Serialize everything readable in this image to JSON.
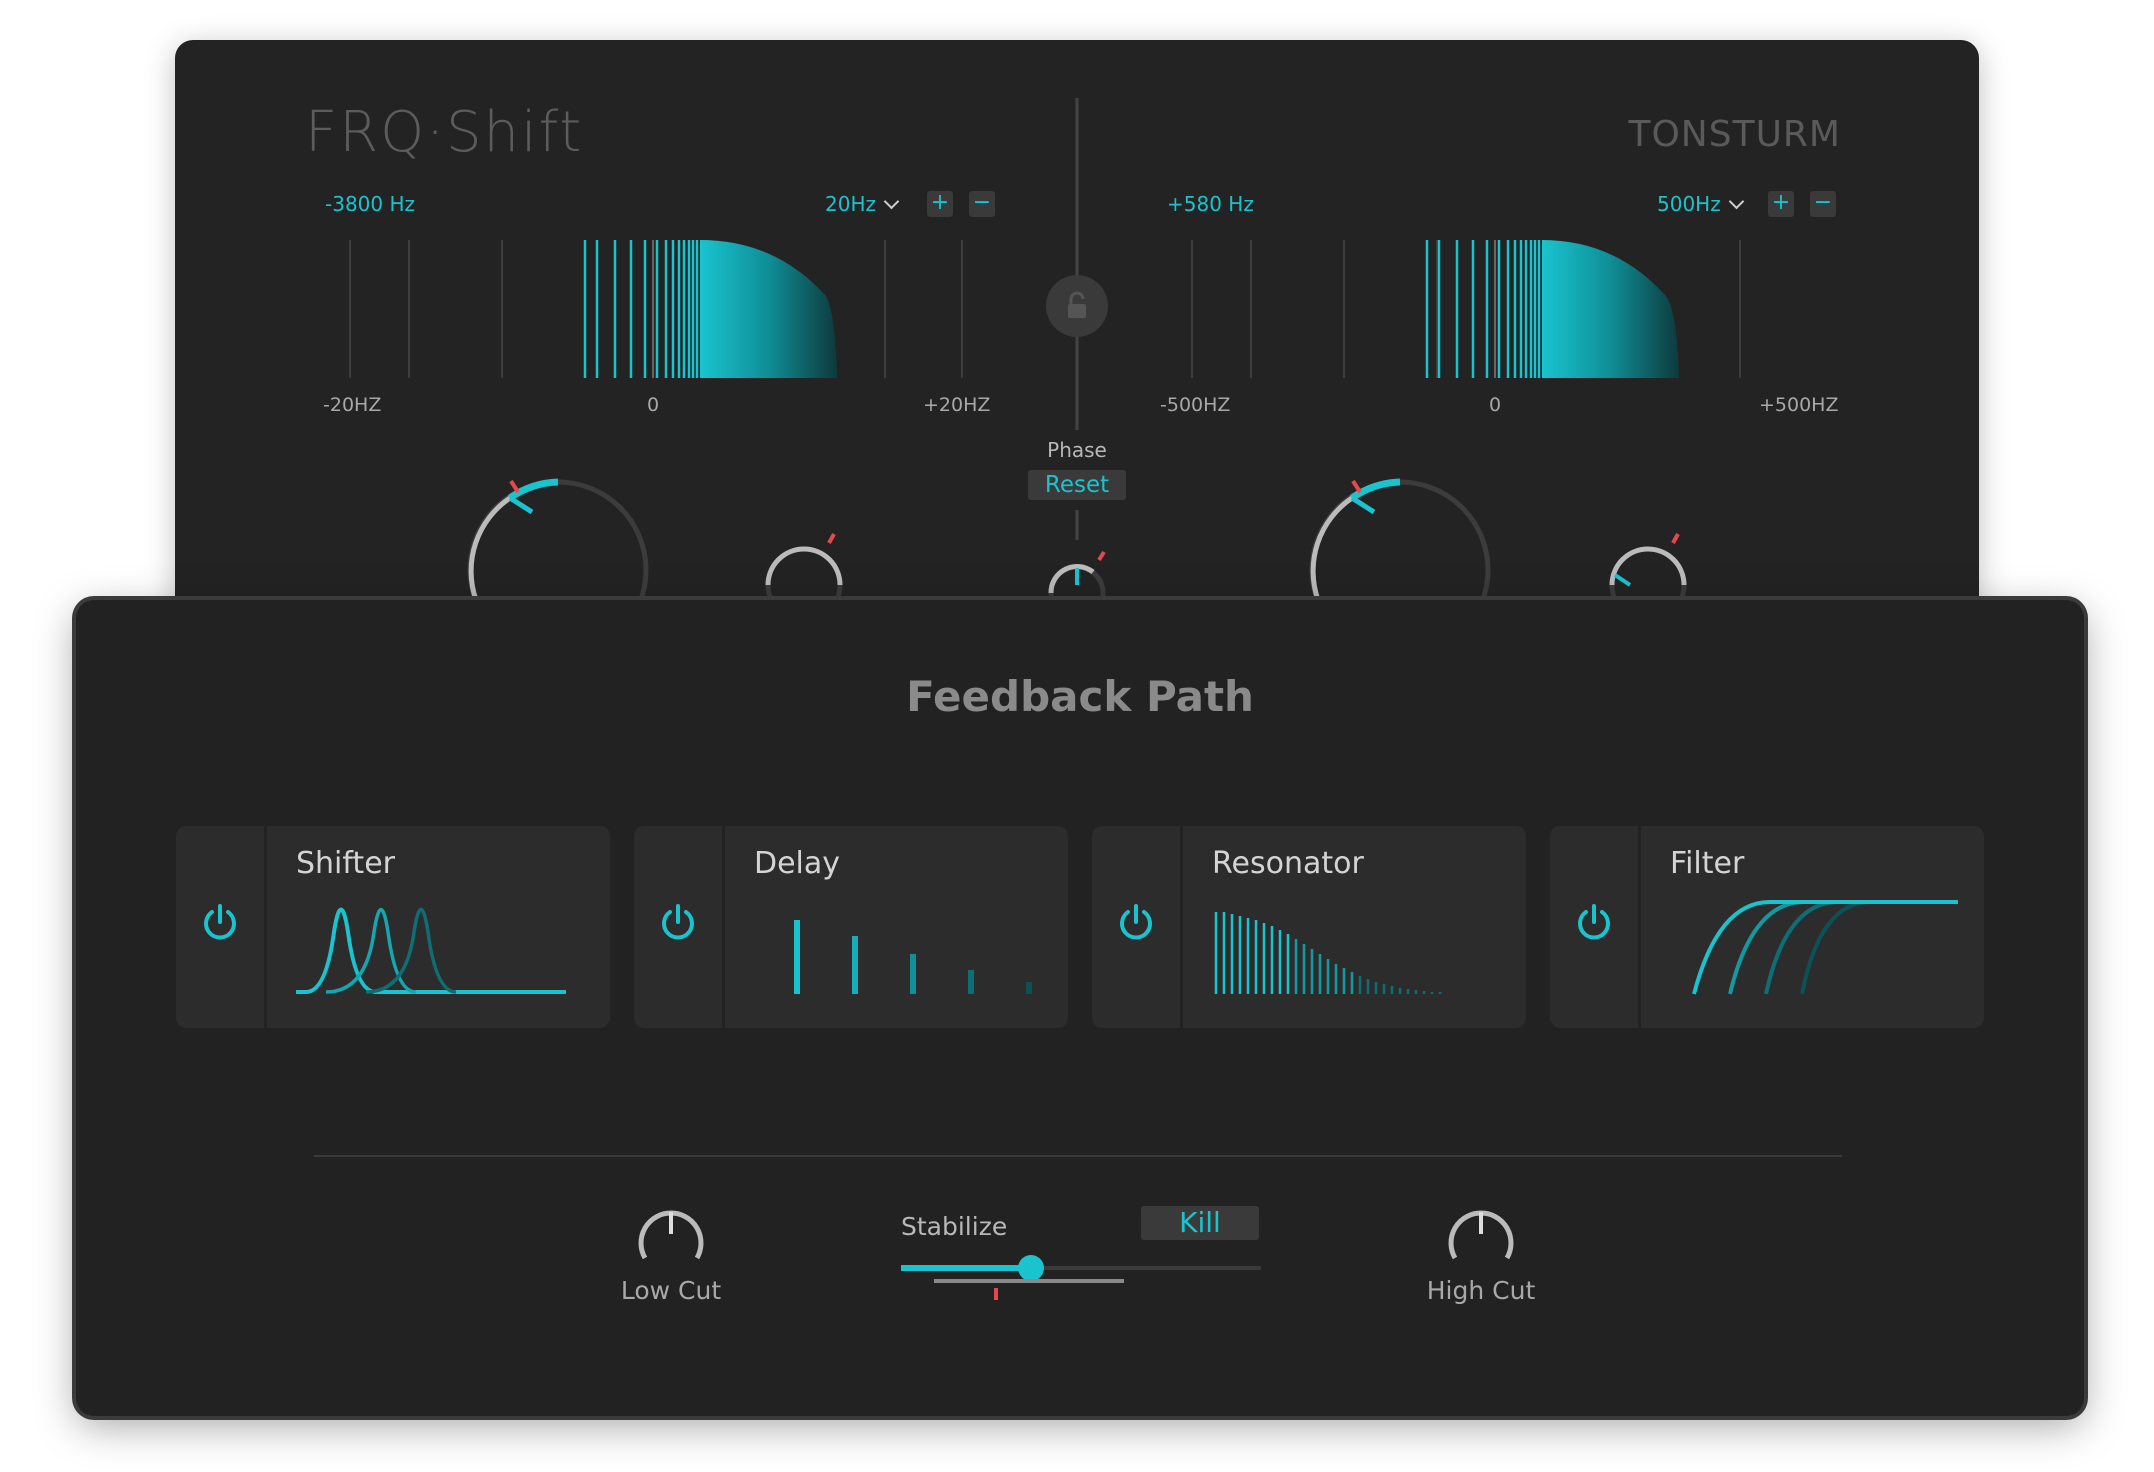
{
  "header": {
    "title": "FRQ·Shift",
    "vendor": "TONSTURM"
  },
  "left_shifter": {
    "frequency_readout": "-3800 Hz",
    "range_selected": "20Hz",
    "plus_label": "+",
    "minus_label": "−",
    "axis_min": "-20HZ",
    "axis_mid": "0",
    "axis_max": "+20HZ"
  },
  "right_shifter": {
    "frequency_readout": "+580 Hz",
    "range_selected": "500Hz",
    "plus_label": "+",
    "minus_label": "−",
    "axis_min": "-500HZ",
    "axis_mid": "0",
    "axis_max": "+500HZ"
  },
  "phase": {
    "label": "Phase",
    "reset_label": "Reset"
  },
  "feedback": {
    "title": "Feedback Path",
    "modules": [
      {
        "name": "Shifter",
        "enabled": true
      },
      {
        "name": "Delay",
        "enabled": true
      },
      {
        "name": "Resonator",
        "enabled": true
      },
      {
        "name": "Filter",
        "enabled": true
      }
    ],
    "low_cut_label": "Low Cut",
    "high_cut_label": "High Cut",
    "stabilize_label": "Stabilize",
    "kill_label": "Kill",
    "stabilize_level": 0.36
  },
  "colors": {
    "accent": "#19c4cf",
    "panel": "#232323",
    "module": "#2c2c2c",
    "marker": "#e5484d"
  },
  "icons": [
    "lock-icon",
    "power-icon",
    "chevron-down-icon",
    "plus-icon",
    "minus-icon"
  ]
}
